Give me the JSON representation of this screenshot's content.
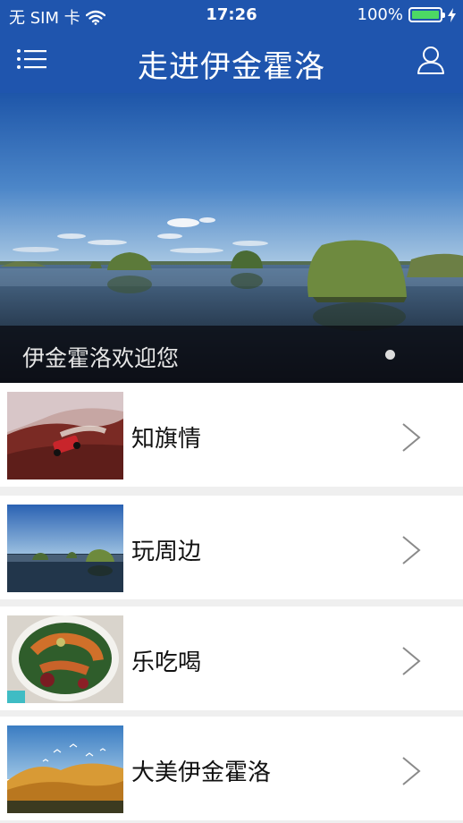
{
  "status_bar": {
    "carrier": "无 SIM 卡",
    "time": "17:26",
    "battery_percent": "100%",
    "battery_level": 1.0,
    "icons": [
      "wifi-icon",
      "battery-icon",
      "charging-bolt-icon"
    ]
  },
  "nav": {
    "title": "走进伊金霍洛",
    "menu_icon": "list-menu-icon",
    "user_icon": "user-icon"
  },
  "banner": {
    "caption": "伊金霍洛欢迎您",
    "page_count": 1,
    "active_page": 1
  },
  "list": {
    "items": [
      {
        "label": "知旗情",
        "thumb": "desert-jeep-photo"
      },
      {
        "label": "玩周边",
        "thumb": "lake-reeds-photo"
      },
      {
        "label": "乐吃喝",
        "thumb": "food-plate-photo"
      },
      {
        "label": "大美伊金霍洛",
        "thumb": "desert-birds-photo"
      }
    ],
    "chevron_icon": "chevron-right-icon"
  },
  "colors": {
    "brand_blue": "#1f55ae",
    "battery_green": "#4cd964",
    "background": "#efefef"
  }
}
